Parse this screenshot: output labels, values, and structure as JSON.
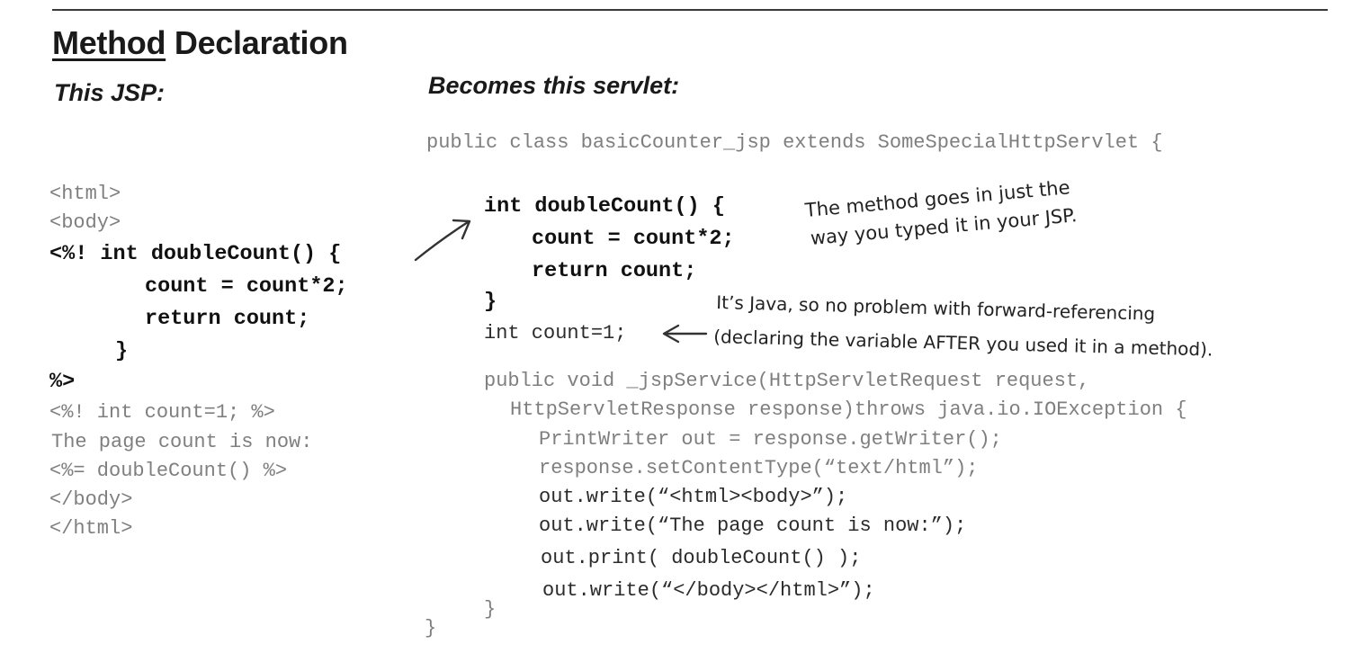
{
  "heading": {
    "title_underlined": "Method",
    "title_rest": " Declaration"
  },
  "jsp": {
    "label": "This JSP:",
    "lines": [
      "<html>",
      "<body>",
      "<%! int doubleCount() {",
      "count = count*2;",
      "return count;",
      "}",
      "%>",
      "<%! int count=1; %>",
      "The page count is now:",
      "<%= doubleCount() %>",
      "</body>",
      "</html>"
    ]
  },
  "servlet": {
    "label": "Becomes this servlet:",
    "lines": [
      "public class basicCounter_jsp extends SomeSpecialHttpServlet {",
      "int doubleCount() {",
      "count = count*2;",
      "return count;",
      "}",
      "int count=1;",
      "public void _jspService(HttpServletRequest request,",
      "HttpServletResponse response)throws java.io.IOException {",
      "PrintWriter out = response.getWriter();",
      "response.setContentType(“text/html”);",
      "out.write(“<html><body>”);",
      "out.write(“The page count is now:”);",
      "out.print( doubleCount() );",
      "out.write(“</body></html>”);",
      "}",
      "}"
    ]
  },
  "annotations": {
    "method_note": [
      "The method goes in just the",
      "way you typed it in your JSP."
    ],
    "forward_note": [
      "It’s Java, so no problem with forward-referencing",
      "(declaring the variable AFTER you used it in a method)."
    ]
  }
}
